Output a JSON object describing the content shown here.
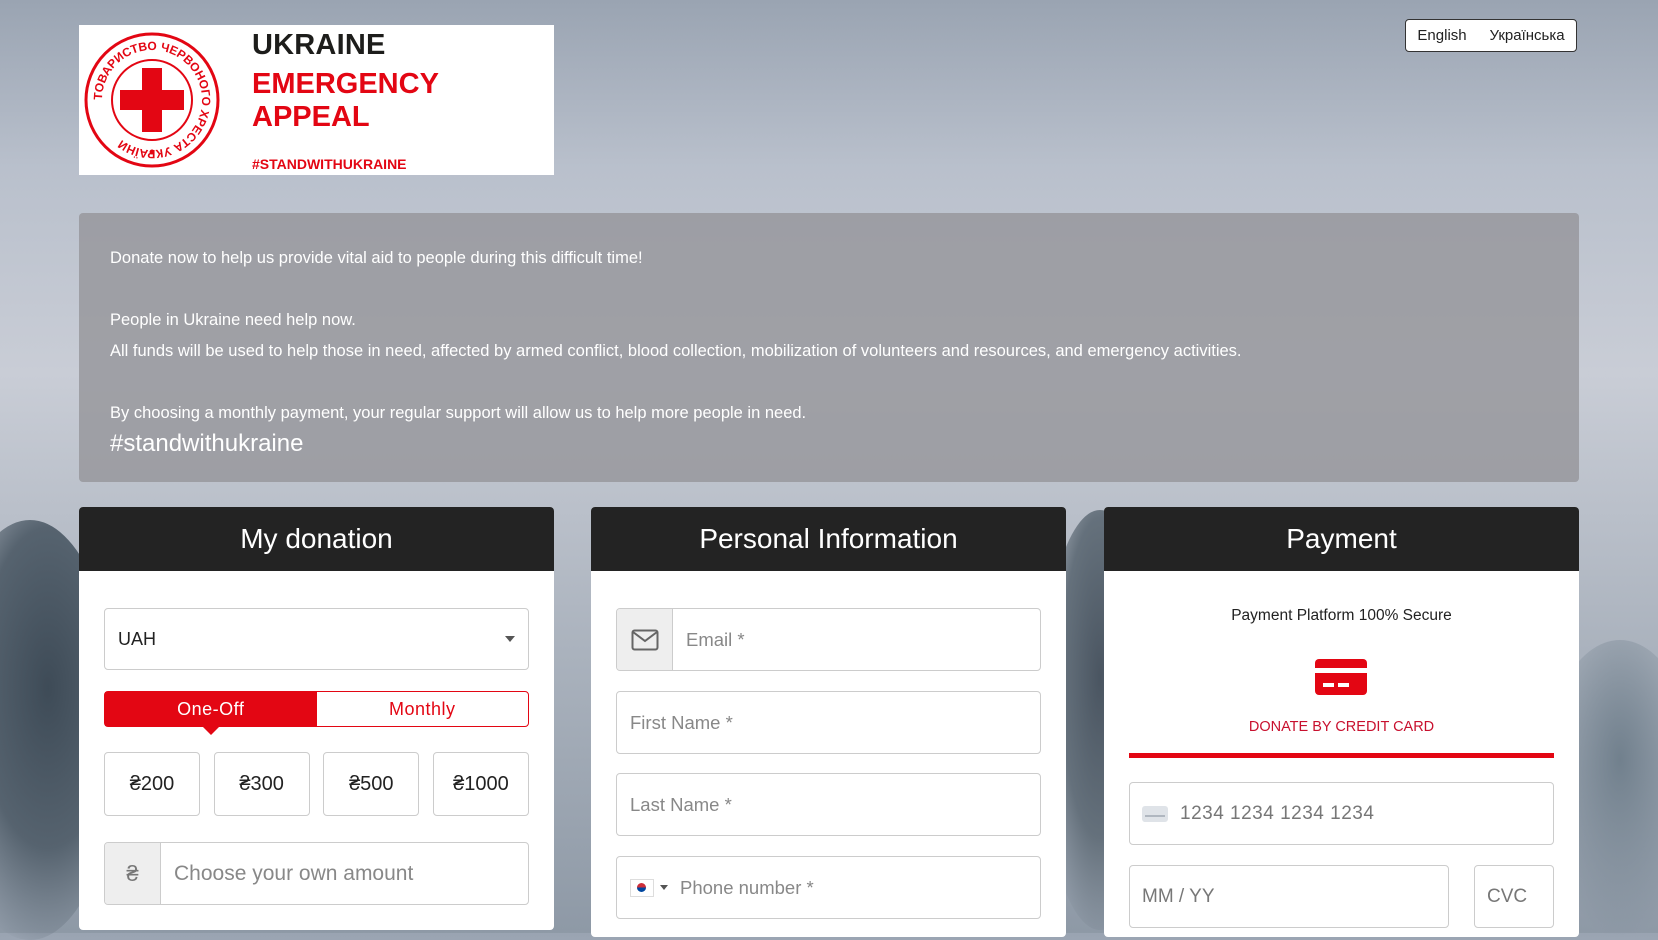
{
  "logo": {
    "seal_text": "ТОВАРИСТВО ЧЕРВОНОГО ХРЕСТА УКРАЇНИ",
    "title_line1": "UKRAINE",
    "title_line2": "EMERGENCY APPEAL",
    "hashtag": "#STANDWITHUKRAINE",
    "brand_red": "#e30613"
  },
  "language": {
    "english": "English",
    "ukrainian": "Українська"
  },
  "intro": {
    "line1": "Donate now to help us provide vital aid to people during this difficult time!",
    "line2": "People in Ukraine need help now.",
    "line3": "All funds will be used to help those in need, affected by armed conflict, blood collection, mobilization of volunteers and resources, and emergency activities.",
    "line4": "By choosing a monthly payment, your regular support will allow us to help more people in need.",
    "hashtag": "#standwithukraine"
  },
  "donation": {
    "title": "My donation",
    "currency": "UAH",
    "one_off": "One-Off",
    "monthly": "Monthly",
    "amounts": [
      "₴200",
      "₴300",
      "₴500",
      "₴1000"
    ],
    "currency_symbol": "₴",
    "own_amount_placeholder": "Choose your own amount"
  },
  "personal": {
    "title": "Personal Information",
    "email_placeholder": "Email *",
    "first_name_placeholder": "First Name *",
    "last_name_placeholder": "Last Name *",
    "phone_placeholder": "Phone number *"
  },
  "payment": {
    "title": "Payment",
    "secure_text": "Payment Platform 100% Secure",
    "method_label": "DONATE BY CREDIT CARD",
    "card_number_placeholder": "1234 1234 1234 1234",
    "expiry_placeholder": "MM / YY",
    "cvc_placeholder": "CVC"
  }
}
